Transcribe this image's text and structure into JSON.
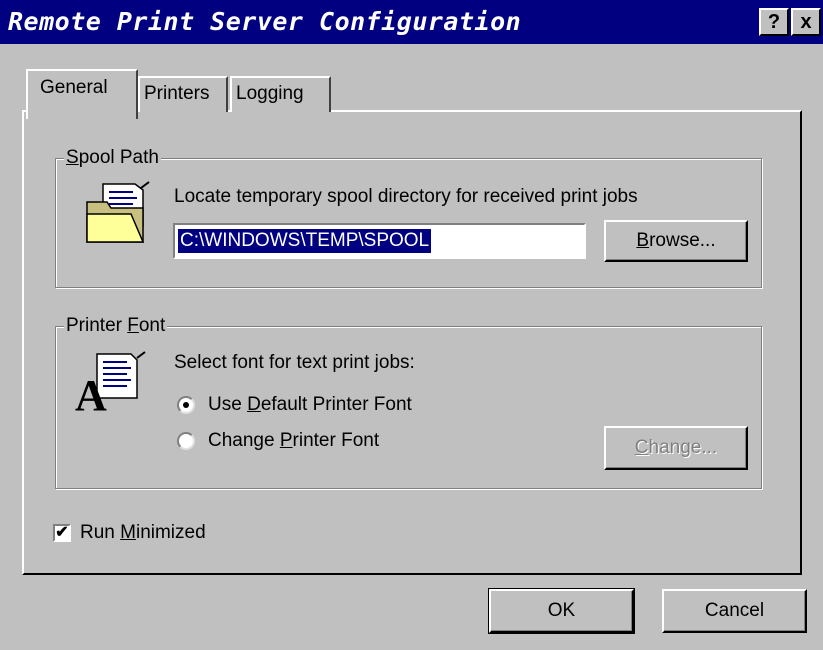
{
  "window": {
    "title": "Remote Print Server Configuration",
    "help_label": "?",
    "close_label": "x"
  },
  "tabs": [
    {
      "label": "General",
      "selected": true
    },
    {
      "label": "Printers",
      "selected": false
    },
    {
      "label": "Logging",
      "selected": false
    }
  ],
  "spool": {
    "group_label_mnemonic": "S",
    "group_label_rest": "pool Path",
    "description": "Locate temporary spool directory for received print jobs",
    "path_value": "C:\\WINDOWS\\TEMP\\SPOOL",
    "browse_mnemonic": "B",
    "browse_rest": "rowse...",
    "icon": "folder-document-icon"
  },
  "printer_font": {
    "group_label_pre": "Printer ",
    "group_label_mnemonic": "F",
    "group_label_rest": "ont",
    "description": "Select font for text print jobs:",
    "option_default_pre": "Use ",
    "option_default_mnemonic": "D",
    "option_default_rest": "efault Printer Font",
    "option_change_pre": "Change ",
    "option_change_mnemonic": "P",
    "option_change_rest": "rinter Font",
    "selected_option": "default",
    "change_mnemonic": "C",
    "change_rest": "hange...",
    "change_enabled": false,
    "icon": "font-document-icon"
  },
  "run_minimized": {
    "label_pre": "Run ",
    "label_mnemonic": "M",
    "label_rest": "inimized",
    "checked": true,
    "check_glyph": "✔"
  },
  "footer": {
    "ok_label": "OK",
    "cancel_label": "Cancel"
  }
}
